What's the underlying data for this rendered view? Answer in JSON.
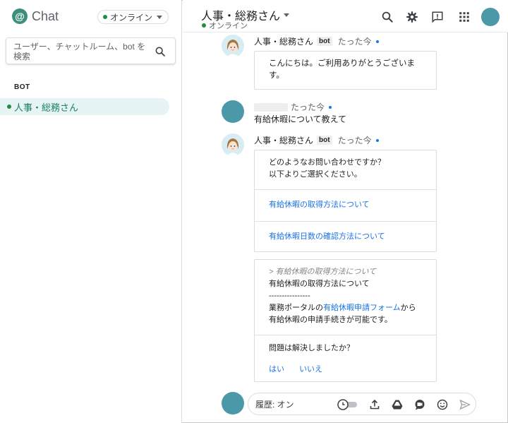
{
  "sidebar": {
    "logo_text": "Chat",
    "status_label": "オンライン",
    "search_placeholder": "ユーザー、チャットルーム、bot を検索",
    "section_bot": "BOT",
    "rooms": [
      {
        "label": "人事・総務さん"
      }
    ]
  },
  "header": {
    "room_title": "人事・総務さん",
    "room_status": "オンライン",
    "icons": [
      "search-icon",
      "settings-icon",
      "feedback-icon",
      "apps-grid-icon",
      "avatar"
    ]
  },
  "messages": [
    {
      "sender": "人事・総務さん",
      "badge": "bot",
      "time": "たった今",
      "text_lines": [
        "こんにちは。ご利用ありがとうございま",
        "す。"
      ]
    },
    {
      "sender": "",
      "time": "たった今",
      "text": "有給休暇について教えて"
    },
    {
      "sender": "人事・総務さん",
      "badge": "bot",
      "time": "たった今",
      "card": {
        "prompt_lines": [
          "どのようなお問い合わせですか？",
          "以下よりご選択ください。"
        ],
        "option1": "有給休暇の取得方法について",
        "option2": "有給休暇日数の確認方法について"
      },
      "answer": {
        "quote": "> 有給休暇の取得方法について",
        "title": "有給休暇の取得方法について",
        "divider": "----------------",
        "line_prefix": "業務ポータルの",
        "line_link": "有給休暇申請フォーム",
        "line_suffix": "から",
        "line2": "有給休暇の申請手続きが可能です。",
        "question": "問題は解決しましたか？",
        "yes": "はい",
        "no": "いいえ"
      }
    }
  ],
  "composer": {
    "placeholder": "履歴: オン",
    "icons": [
      "history-toggle-icon",
      "upload-icon",
      "drive-icon",
      "meet-icon",
      "emoji-icon",
      "send-icon"
    ]
  },
  "colors": {
    "online": "#1e8e3e",
    "link": "#1a73e8",
    "room_highlight": "#e6f4f6",
    "room_text": "#1a7f64",
    "avatar": "#4a98a8"
  }
}
